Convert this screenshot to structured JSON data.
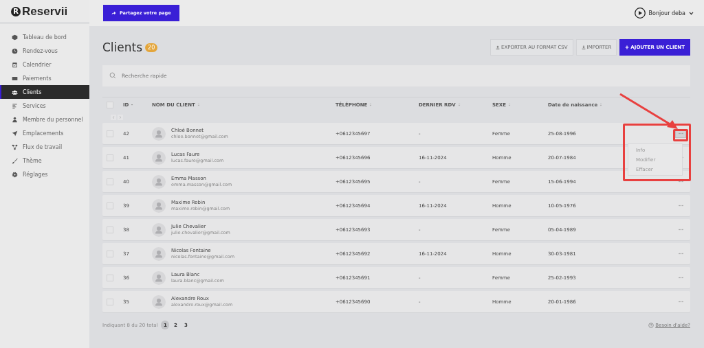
{
  "brand": {
    "name": "Reservii",
    "mark": "R"
  },
  "sidebar": {
    "items": [
      {
        "label": "Tableau de bord",
        "selected": false
      },
      {
        "label": "Rendez-vous",
        "selected": false
      },
      {
        "label": "Calendrier",
        "selected": false
      },
      {
        "label": "Paiements",
        "selected": false
      },
      {
        "label": "Clients",
        "selected": true
      },
      {
        "label": "Services",
        "selected": false
      },
      {
        "label": "Membre du personnel",
        "selected": false
      },
      {
        "label": "Emplacements",
        "selected": false
      },
      {
        "label": "Flux de travail",
        "selected": false
      },
      {
        "label": "Thème",
        "selected": false
      },
      {
        "label": "Réglages",
        "selected": false
      }
    ]
  },
  "topbar": {
    "share_button": "Partagez votre page",
    "greeting": "Bonjour deba"
  },
  "page": {
    "title": "Clients",
    "count": "20",
    "buttons": [
      {
        "label": "EXPORTER AU FORMAT CSV",
        "kind": "export"
      },
      {
        "label": "IMPORTER",
        "kind": "import"
      },
      {
        "label": "AJOUTER UN CLIENT",
        "kind": "add"
      }
    ],
    "search": {
      "placeholder": "Recherche rapide"
    }
  },
  "table": {
    "header_checked": false,
    "columns": [
      {
        "label": "ID",
        "sorted": true
      },
      {
        "label": "NOM DU CLIENT",
        "sorted": false
      },
      {
        "label": "TÉLÉPHONE",
        "sorted": false
      },
      {
        "label": "DERNIER RDV",
        "sorted": false
      },
      {
        "label": "SEXE",
        "sorted": false
      },
      {
        "label": "Date de naissance",
        "sorted": false
      }
    ],
    "row_menu": [
      "Info",
      "Modifier",
      "Effacer"
    ],
    "rows": [
      {
        "id": "42",
        "name": "Chloé Bonnet",
        "email": "chloe.bonnet@gmail.com",
        "phone": "+0612345697",
        "last_appointment": "-",
        "gender": "Femme",
        "birth_date": "25-08-1996",
        "checked": false,
        "menu_open": true
      },
      {
        "id": "41",
        "name": "Lucas Faure",
        "email": "lucas.faure@gmail.com",
        "phone": "+0612345696",
        "last_appointment": "16-11-2024",
        "gender": "Homme",
        "birth_date": "20-07-1984",
        "checked": false,
        "menu_open": false
      },
      {
        "id": "40",
        "name": "Emma Masson",
        "email": "emma.masson@gmail.com",
        "phone": "+0612345695",
        "last_appointment": "-",
        "gender": "Femme",
        "birth_date": "15-06-1994",
        "checked": false,
        "menu_open": false
      },
      {
        "id": "39",
        "name": "Maxime Robin",
        "email": "maxime.robin@gmail.com",
        "phone": "+0612345694",
        "last_appointment": "16-11-2024",
        "gender": "Homme",
        "birth_date": "10-05-1976",
        "checked": false,
        "menu_open": false
      },
      {
        "id": "38",
        "name": "Julie Chevalier",
        "email": "julie.chevalier@gmail.com",
        "phone": "+0612345693",
        "last_appointment": "-",
        "gender": "Femme",
        "birth_date": "05-04-1989",
        "checked": false,
        "menu_open": false
      },
      {
        "id": "37",
        "name": "Nicolas Fontaine",
        "email": "nicolas.fontaine@gmail.com",
        "phone": "+0612345692",
        "last_appointment": "16-11-2024",
        "gender": "Homme",
        "birth_date": "30-03-1981",
        "checked": false,
        "menu_open": false
      },
      {
        "id": "36",
        "name": "Laura Blanc",
        "email": "laura.blanc@gmail.com",
        "phone": "+0612345691",
        "last_appointment": "-",
        "gender": "Femme",
        "birth_date": "25-02-1993",
        "checked": false,
        "menu_open": false
      },
      {
        "id": "35",
        "name": "Alexandre Roux",
        "email": "alexandre.roux@gmail.com",
        "phone": "+0612345690",
        "last_appointment": "-",
        "gender": "Homme",
        "birth_date": "20-01-1986",
        "checked": false,
        "menu_open": false
      }
    ]
  },
  "footer": {
    "summary": "Indiquant 8 du 20 total",
    "pages": [
      {
        "label": "1",
        "selected": true
      },
      {
        "label": "2",
        "selected": false
      },
      {
        "label": "3",
        "selected": false
      }
    ],
    "help_link": "Besoin d'aide?"
  }
}
